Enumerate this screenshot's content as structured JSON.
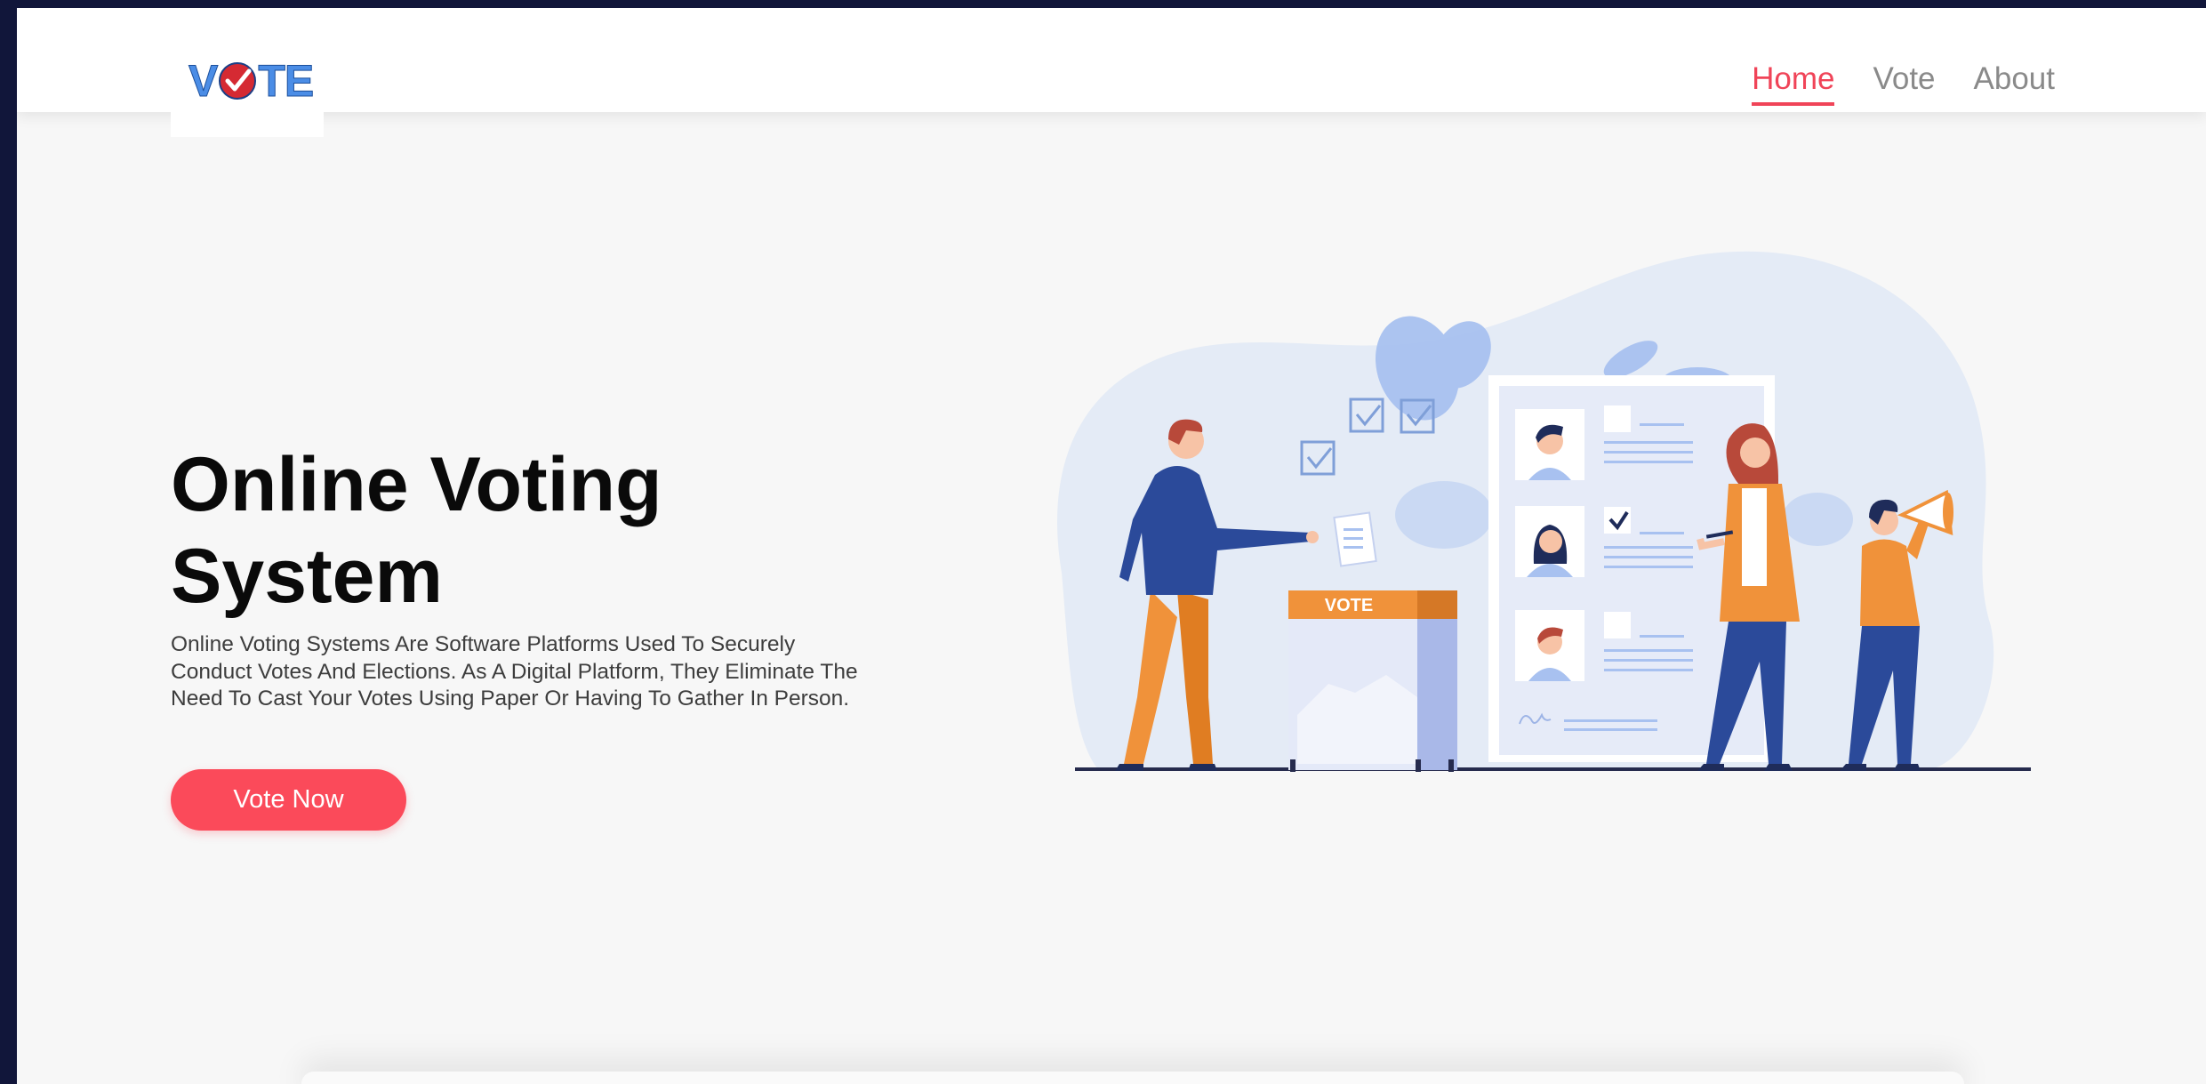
{
  "brand": {
    "logo_text_left": "V",
    "logo_text_right": "TE",
    "logo_alt": "VOTE"
  },
  "nav": {
    "items": [
      {
        "label": "Home",
        "active": true
      },
      {
        "label": "Vote",
        "active": false
      },
      {
        "label": "About",
        "active": false
      }
    ]
  },
  "hero": {
    "title_line1": "Online Voting",
    "title_line2": "System",
    "description": "Online Voting Systems Are Software Platforms Used To Securely Conduct Votes And Elections. As A Digital Platform, They Eliminate The Need To Cast Your Votes Using Paper Or Having To Gather In Person.",
    "cta_label": "Vote Now"
  },
  "illustration": {
    "ballot_box_label": "VOTE"
  },
  "colors": {
    "accent": "#fb4a5a",
    "nav_active": "#f04458",
    "nav_inactive": "#8a8a8a",
    "page_bg": "#f7f7f7",
    "outer_bg": "#11163a"
  }
}
